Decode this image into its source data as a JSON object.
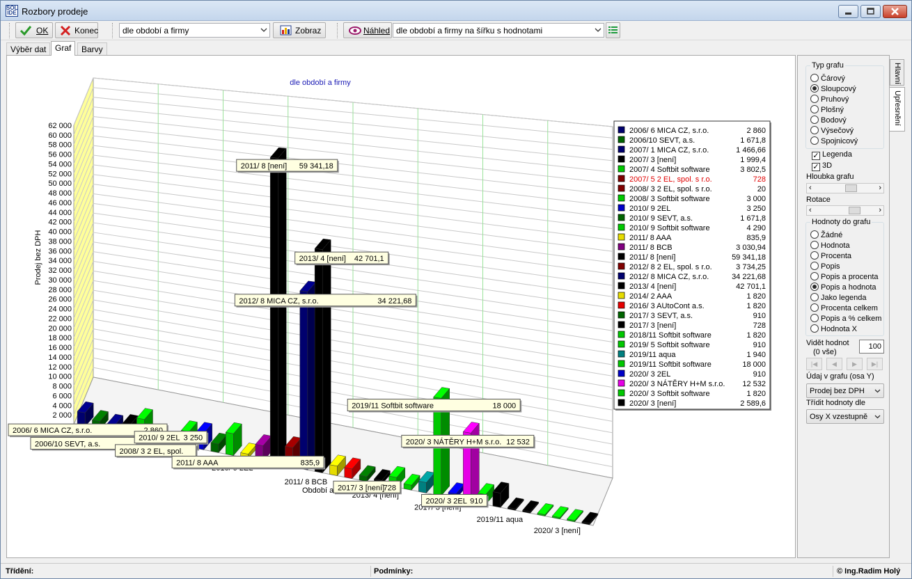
{
  "window": {
    "title": "Rozbory prodeje",
    "icon_text": [
      "SOL",
      "IDE"
    ]
  },
  "toolbar": {
    "ok_label": "OK",
    "close_label": "Konec",
    "report_combo_value": "dle období a firmy",
    "show_label": "Zobraz",
    "preview_label": "Náhled",
    "preview_combo_value": "dle období a firmy na šířku s hodnotami"
  },
  "tabs": [
    {
      "label": "Výběr dat",
      "active": false
    },
    {
      "label": "Graf",
      "active": true
    },
    {
      "label": "Barvy",
      "active": false
    }
  ],
  "side_tabs": [
    "Hlavní",
    "Upřesnění"
  ],
  "options": {
    "chart_type_title": "Typ grafu",
    "chart_types": [
      "Čárový",
      "Sloupcový",
      "Pruhový",
      "Plošný",
      "Bodový",
      "Výsečový",
      "Spojnicový"
    ],
    "chart_type_selected": "Sloupcový",
    "legend_label": "Legenda",
    "legend_checked": true,
    "threed_label": "3D",
    "threed_checked": true,
    "depth_label": "Hloubka grafu",
    "depth_value": 0.6,
    "rotation_label": "Rotace",
    "rotation_value": 0.68,
    "values_title": "Hodnoty do grafu",
    "value_options": [
      "Žádné",
      "Hodnota",
      "Procenta",
      "Popis",
      "Popis a procenta",
      "Popis a hodnota",
      "Jako legenda",
      "Procenta celkem",
      "Popis a % celkem",
      "Hodnota X"
    ],
    "value_selected": "Popis a hodnota",
    "visible_label": "Vidět hodnot",
    "visible_sub": "(0 vše)",
    "visible_value": "100",
    "nav_buttons": [
      "|◀",
      "◀",
      "▶",
      "▶|"
    ],
    "y_label": "Údaj v grafu (osa Y)",
    "y_value": "Prodej bez DPH",
    "sort_label": "Třídit hodnoty dle",
    "sort_value": "Osy X vzestupně"
  },
  "status": {
    "sort_label": "Třídění:",
    "cond_label": "Podmínky:",
    "copyright": "© Ing.Radim Holý"
  },
  "colors": {
    "legend_highlight": "#e00000"
  },
  "chart_data": {
    "type": "bar",
    "title": "dle období a firmy",
    "ylabel": "Prodej bez DPH",
    "xlabel": "Období a firma",
    "ylim": [
      0,
      62000
    ],
    "y_ticks": [
      "2 000",
      "4 000",
      "6 000",
      "8 000",
      "10 000",
      "12 000",
      "14 000",
      "16 000",
      "18 000",
      "20 000",
      "22 000",
      "24 000",
      "26 000",
      "28 000",
      "30 000",
      "32 000",
      "34 000",
      "36 000",
      "38 000",
      "40 000",
      "42 000",
      "44 000",
      "46 000",
      "48 000",
      "50 000",
      "52 000",
      "54 000",
      "56 000",
      "58 000",
      "60 000",
      "62 000"
    ],
    "x_tick_labels": [
      "2006/ 6 MICA CZ, s.r.o.",
      "2007/ 4 Softbit software",
      "2010/ 9 2EL",
      "2011/ 8 BCB",
      "2013/ 4 [není]",
      "2017/ 3 [není]",
      "2019/11 aqua",
      "2020/ 3 [není]"
    ],
    "legend": [
      {
        "name": "2006/ 6 MICA CZ, s.r.o.",
        "value": "2 860",
        "color": "#00006e",
        "highlight": false
      },
      {
        "name": "2006/10 SEVT, a.s.",
        "value": "1 671,8",
        "color": "#006400",
        "highlight": false
      },
      {
        "name": "2007/ 1 MICA CZ, s.r.o.",
        "value": "1 466,66",
        "color": "#00006e",
        "highlight": false
      },
      {
        "name": "2007/ 3 [není]",
        "value": "1 999,4",
        "color": "#000000",
        "highlight": false
      },
      {
        "name": "2007/ 4 Softbit software",
        "value": "3 802,5",
        "color": "#00c800",
        "highlight": false
      },
      {
        "name": "2007/ 5 2 EL, spol. s r.o.",
        "value": "728",
        "color": "#800000",
        "highlight": true
      },
      {
        "name": "2008/ 3 2 EL, spol. s r.o.",
        "value": "20",
        "color": "#800000",
        "highlight": false
      },
      {
        "name": "2008/ 3 Softbit software",
        "value": "3 000",
        "color": "#00c800",
        "highlight": false
      },
      {
        "name": "2010/ 9 2EL",
        "value": "3 250",
        "color": "#0000c8",
        "highlight": false
      },
      {
        "name": "2010/ 9 SEVT, a.s.",
        "value": "1 671,8",
        "color": "#006400",
        "highlight": false
      },
      {
        "name": "2010/ 9 Softbit software",
        "value": "4 290",
        "color": "#00c800",
        "highlight": false
      },
      {
        "name": "2011/ 8 AAA",
        "value": "835,9",
        "color": "#e6dc00",
        "highlight": false
      },
      {
        "name": "2011/ 8 BCB",
        "value": "3 030,94",
        "color": "#800080",
        "highlight": false
      },
      {
        "name": "2011/ 8 [není]",
        "value": "59 341,18",
        "color": "#000000",
        "highlight": false
      },
      {
        "name": "2012/ 8 2 EL, spol. s r.o.",
        "value": "3 734,25",
        "color": "#800000",
        "highlight": false
      },
      {
        "name": "2012/ 8 MICA CZ, s.r.o.",
        "value": "34 221,68",
        "color": "#00006e",
        "highlight": false
      },
      {
        "name": "2013/ 4 [není]",
        "value": "42 701,1",
        "color": "#000000",
        "highlight": false
      },
      {
        "name": "2014/ 2 AAA",
        "value": "1 820",
        "color": "#e6dc00",
        "highlight": false
      },
      {
        "name": "2016/ 3 AUtoCont a.s.",
        "value": "1 820",
        "color": "#e60000",
        "highlight": false
      },
      {
        "name": "2017/ 3 SEVT, a.s.",
        "value": "910",
        "color": "#006400",
        "highlight": false
      },
      {
        "name": "2017/ 3 [není]",
        "value": "728",
        "color": "#000000",
        "highlight": false
      },
      {
        "name": "2018/11 Softbit software",
        "value": "1 820",
        "color": "#00c800",
        "highlight": false
      },
      {
        "name": "2019/ 5 Softbit software",
        "value": "910",
        "color": "#00c800",
        "highlight": false
      },
      {
        "name": "2019/11 aqua",
        "value": "1 940",
        "color": "#008080",
        "highlight": false
      },
      {
        "name": "2019/11 Softbit software",
        "value": "18 000",
        "color": "#00c800",
        "highlight": false
      },
      {
        "name": "2020/ 3 2EL",
        "value": "910",
        "color": "#0000c8",
        "highlight": false
      },
      {
        "name": "2020/ 3 NÁTĚRY H+M s.r.o.",
        "value": "12 532",
        "color": "#e600e6",
        "highlight": false
      },
      {
        "name": "2020/ 3 Softbit software",
        "value": "1 820",
        "color": "#00c800",
        "highlight": false
      },
      {
        "name": "2020/ 3 [není]",
        "value": "2 589,6",
        "color": "#000000",
        "highlight": false
      }
    ],
    "extra_bars": [
      {
        "color": "#000000",
        "value": 0
      },
      {
        "color": "#000000",
        "value": 0
      },
      {
        "color": "#00c800",
        "value": 0
      },
      {
        "color": "#00c800",
        "value": 0
      },
      {
        "color": "#00c800",
        "value": 0
      },
      {
        "color": "#000000",
        "value": 0
      }
    ],
    "annotations": [
      {
        "label": "2011/ 8 [není]",
        "value": "59 341,18",
        "bar": 13
      },
      {
        "label": "2013/ 4 [není]",
        "value": "42 701,1",
        "bar": 16
      },
      {
        "label": "2012/ 8 MICA CZ, s.r.o.",
        "value": "34 221,68",
        "bar": 15
      },
      {
        "label": "2006/ 6 MICA CZ, s.r.o.",
        "value": "2 860",
        "bar": 0
      },
      {
        "label": "2006/10 SEVT, a.s.",
        "value": "1 671,8",
        "bar": 1
      },
      {
        "label": "2010/ 9 2EL",
        "value": "3 250",
        "bar": 8
      },
      {
        "label": "2008/ 3 2 EL, spol.",
        "value": "",
        "bar": 6
      },
      {
        "label": "2011/ 8 AAA",
        "value": "835,9",
        "bar": 11
      },
      {
        "label": "2019/11 Softbit software",
        "value": "18 000",
        "bar": 24
      },
      {
        "label": "2020/ 3 NÁTĚRY H+M s.r.o.",
        "value": "12 532",
        "bar": 26
      },
      {
        "label": "2017/ 3 [není]",
        "value": "728",
        "bar": 20
      },
      {
        "label": "2020/ 3 2EL",
        "value": "910",
        "bar": 25
      }
    ]
  }
}
